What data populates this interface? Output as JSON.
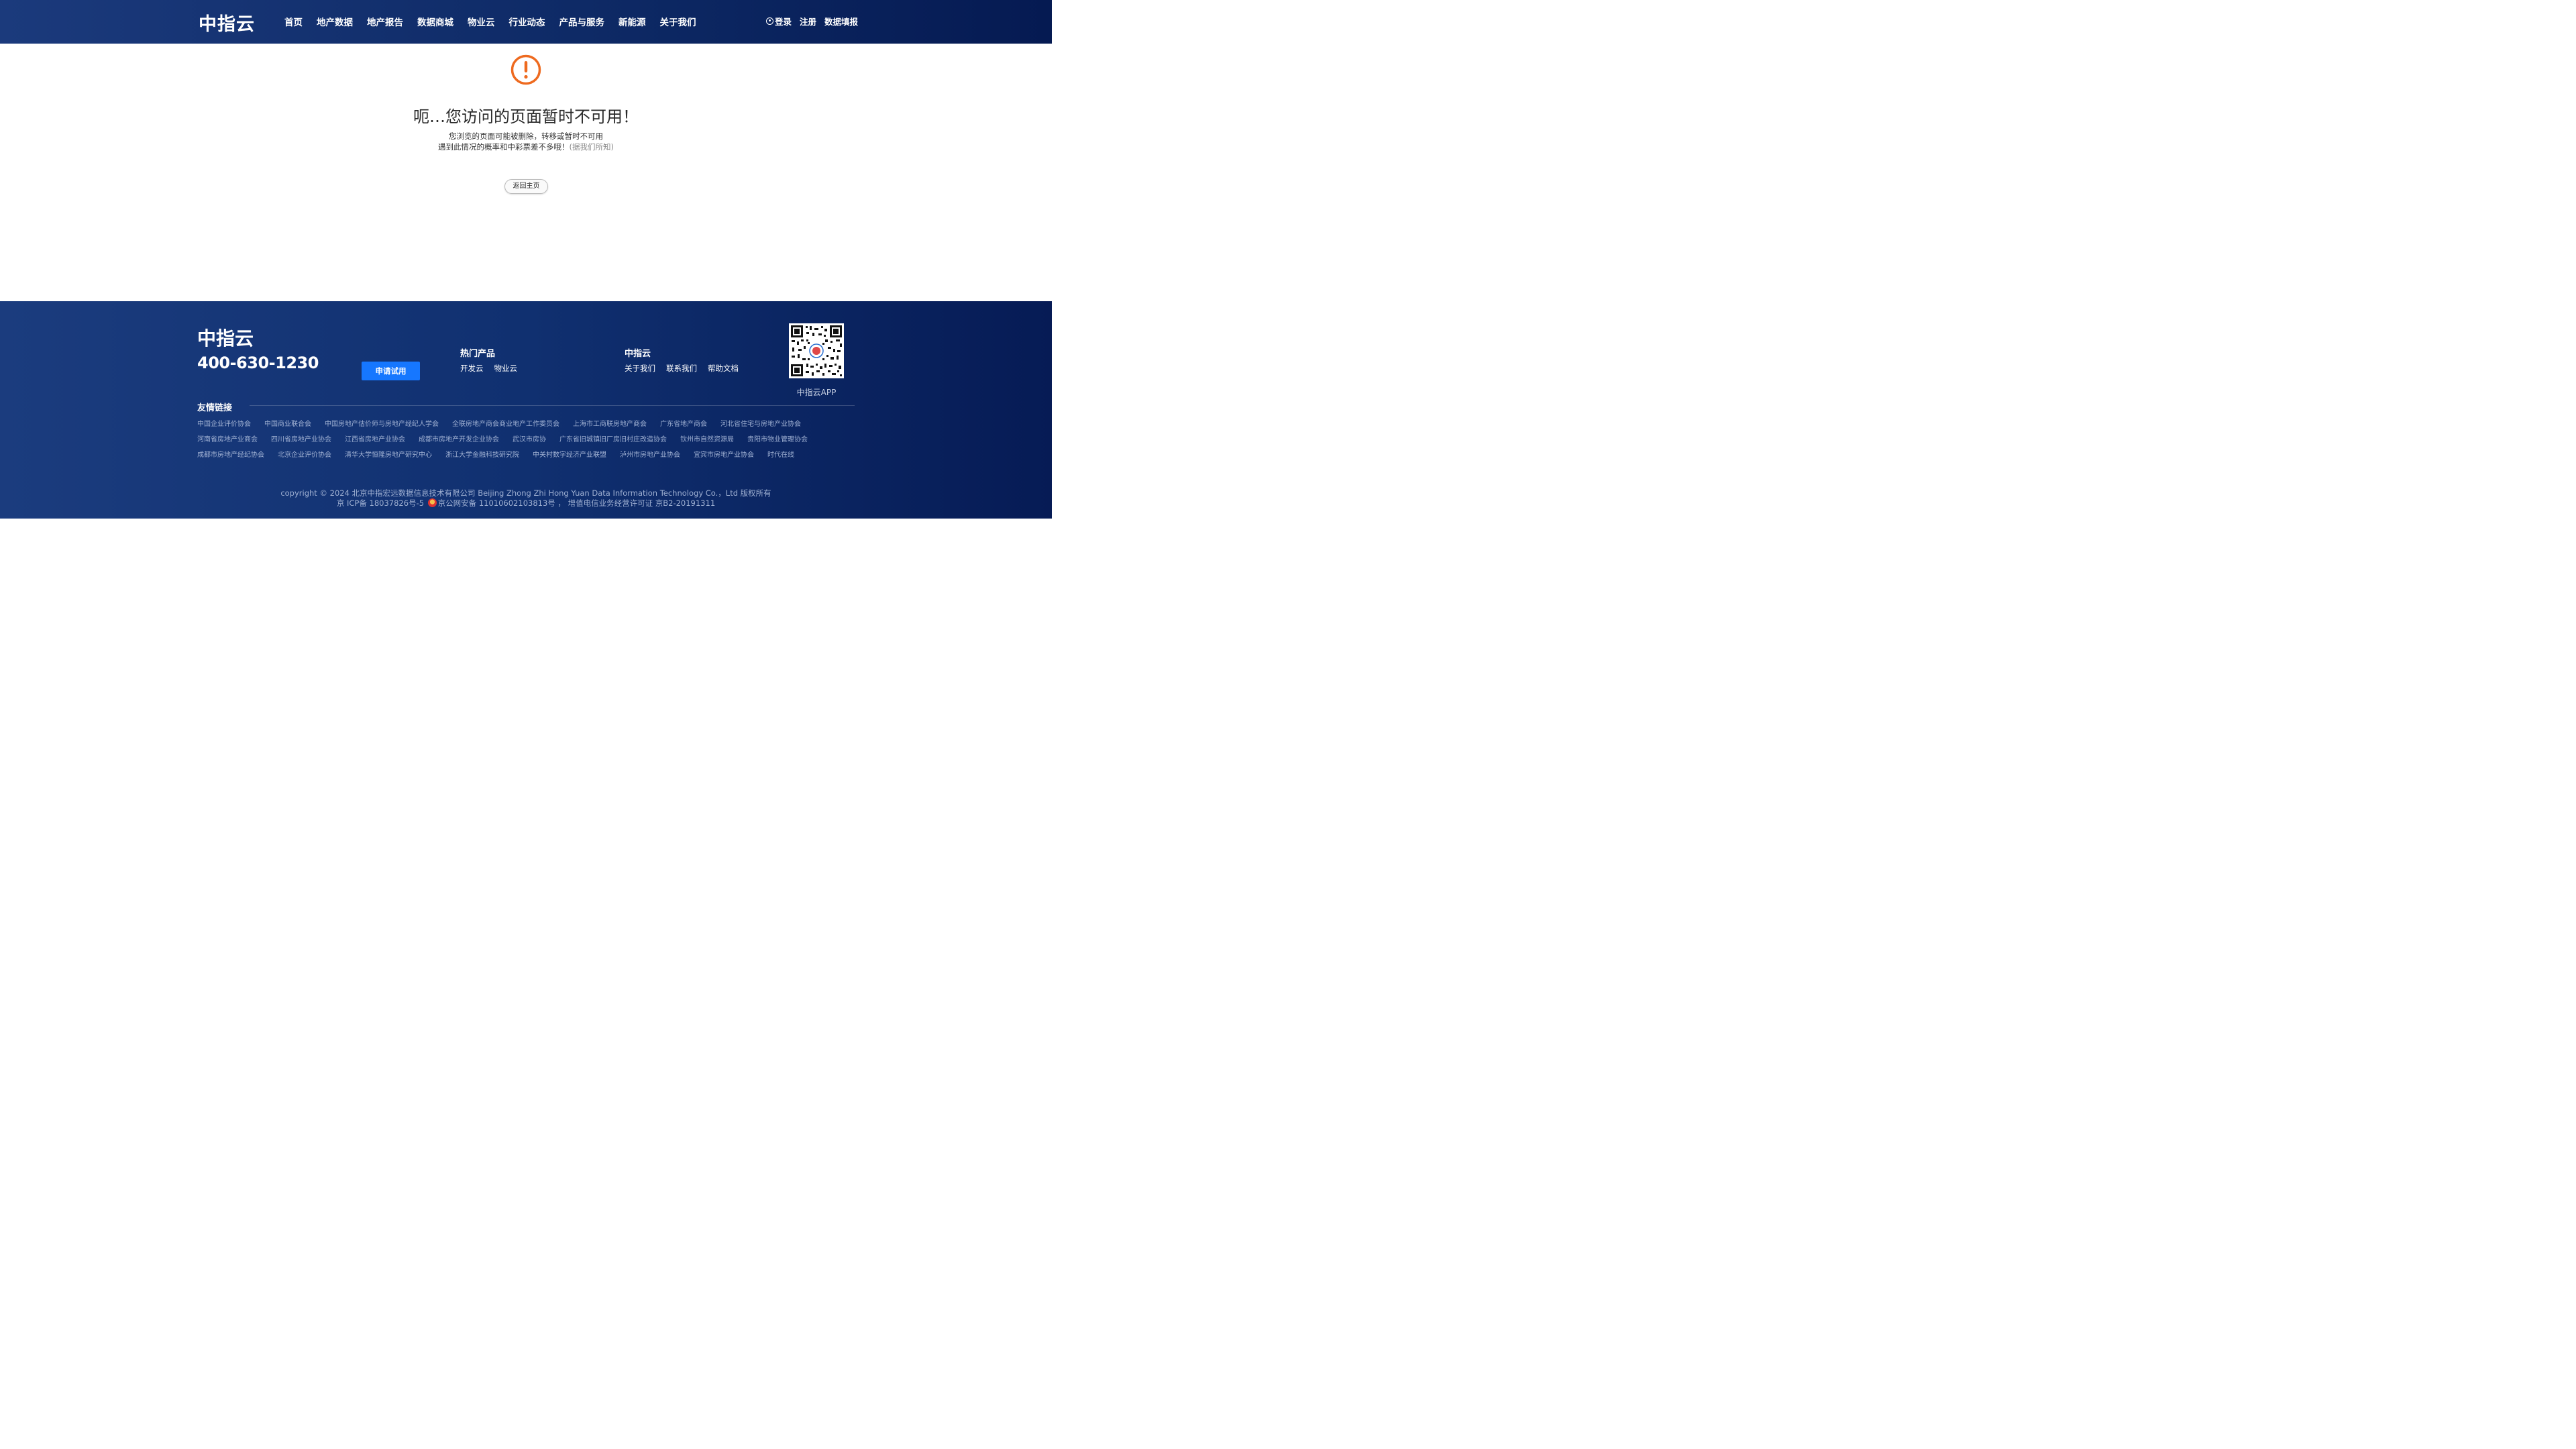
{
  "header": {
    "logo": "中指云",
    "nav": [
      "首页",
      "地产数据",
      "地产报告",
      "数据商城",
      "物业云",
      "行业动态",
      "产品与服务",
      "新能源",
      "关于我们"
    ],
    "login": "登录",
    "register": "注册",
    "data_report": "数据填报"
  },
  "error": {
    "title": "呃…您访问的页面暂时不可用！",
    "line1": "您浏览的页面可能被删除，转移或暂时不可用",
    "line2": "遇到此情况的概率和中彩票差不多哦！",
    "line2_note": "(据我们所知)",
    "home_button": "返回主页"
  },
  "footer": {
    "logo": "中指云",
    "phone": "400-630-1230",
    "trial_button": "申请试用",
    "hot_products_title": "热门产品",
    "hot_products": [
      "开发云",
      "物业云"
    ],
    "company_title": "中指云",
    "company_links": [
      "关于我们",
      "联系我们",
      "帮助文档"
    ],
    "qr_label": "中指云APP",
    "friends_title": "友情链接",
    "friend_links_row1": [
      "中国企业评价协会",
      "中国商业联合会",
      "中国房地产估价师与房地产经纪人学会",
      "全联房地产商会商业地产工作委员会",
      "上海市工商联房地产商会",
      "广东省地产商会",
      "河北省住宅与房地产业协会"
    ],
    "friend_links_row2": [
      "河南省房地产业商会",
      "四川省房地产业协会",
      "江西省房地产业协会",
      "成都市房地产开发企业协会",
      "武汉市房协",
      "广东省旧城镇旧厂房旧村庄改造协会",
      "钦州市自然资源局",
      "贵阳市物业管理协会"
    ],
    "friend_links_row3": [
      "成都市房地产经纪协会",
      "北京企业评价协会",
      "清华大学恒隆房地产研究中心",
      "浙江大学金融科技研究院",
      "中关村数字经济产业联盟",
      "泸州市房地产业协会",
      "宜宾市房地产业协会",
      "时代在线"
    ],
    "copyright": "copyright © 2024 北京中指宏远数据信息技术有限公司 Beijing Zhong Zhi Hong Yuan Data Information Technology Co.，Ltd 版权所有",
    "icp": "京 ICP备 18037826号-5",
    "police": "京公网安备 11010602103813号 ，  增值电信业务经营许可证 京B2-20191311"
  },
  "colors": {
    "header_bg": "#0e2a66",
    "accent_blue": "#1677ff",
    "warning_orange": "#ee6a1f"
  }
}
